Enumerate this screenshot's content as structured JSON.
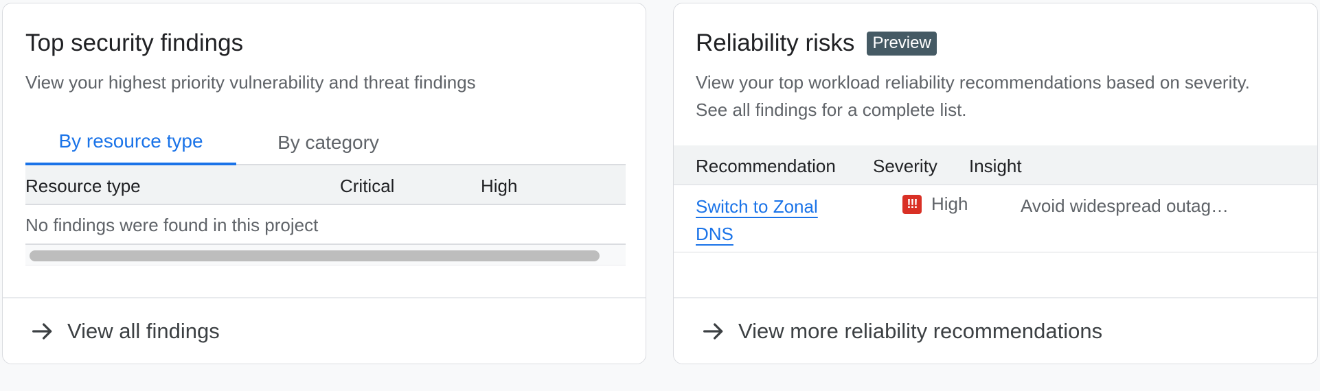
{
  "security": {
    "title": "Top security findings",
    "description": "View your highest priority vulnerability and threat findings",
    "tabs": [
      {
        "label": "By resource type",
        "active": true
      },
      {
        "label": "By category",
        "active": false
      }
    ],
    "table": {
      "columns": [
        "Resource type",
        "Critical",
        "High"
      ],
      "empty_message": "No findings were found in this project"
    },
    "footer_link": "View all findings"
  },
  "reliability": {
    "title": "Reliability risks",
    "badge": "Preview",
    "description": "View your top workload reliability recommendations based on severity. See all findings for a complete list.",
    "table": {
      "columns": [
        "Recommendation",
        "Severity",
        "Insight"
      ],
      "rows": [
        {
          "recommendation": "Switch to Zonal DNS",
          "severity_icon": "!!!",
          "severity": "High",
          "insight": "Avoid widespread outag…"
        }
      ]
    },
    "footer_link": "View more reliability recommendations"
  },
  "colors": {
    "accent": "#1a73e8",
    "severity_high": "#d93025",
    "badge_bg": "#455a64"
  }
}
